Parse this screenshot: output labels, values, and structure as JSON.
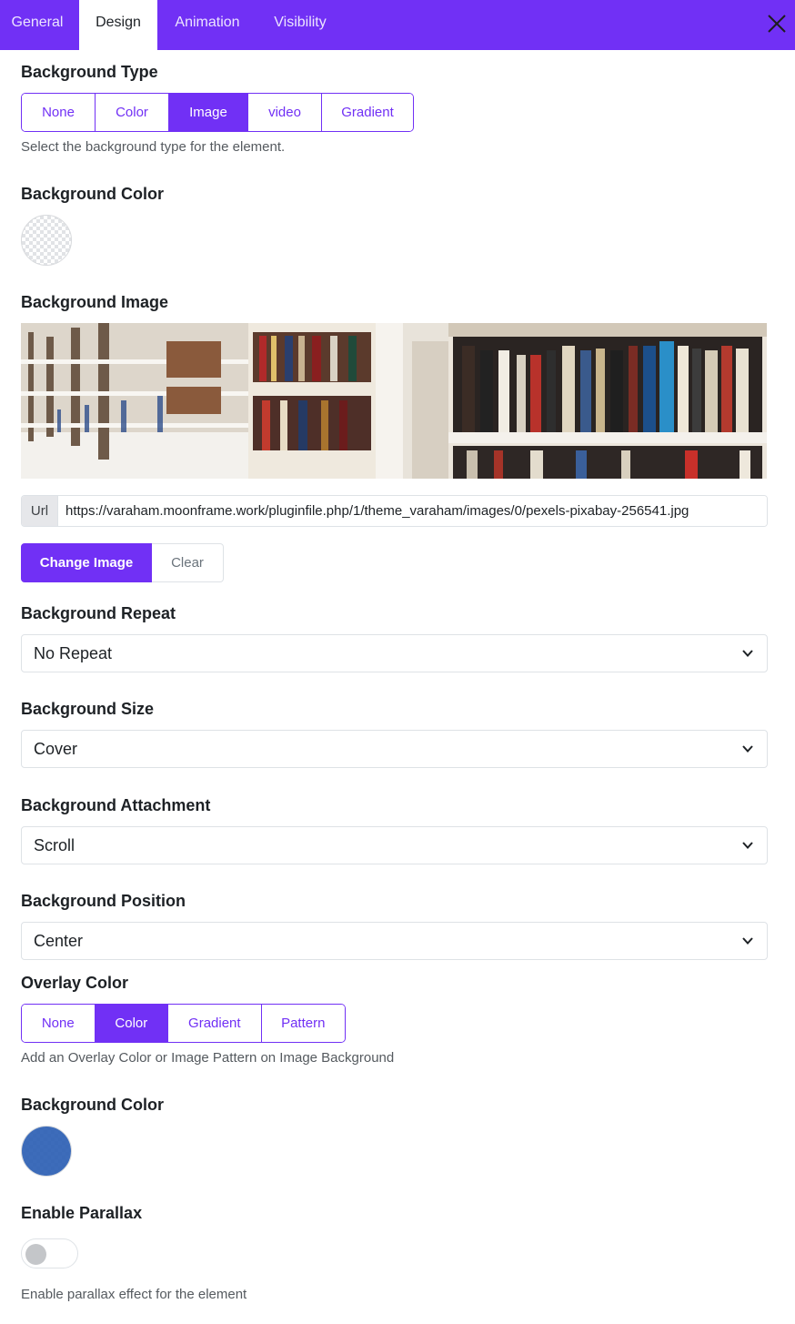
{
  "tabs": [
    {
      "label": "General",
      "active": false
    },
    {
      "label": "Design",
      "active": true
    },
    {
      "label": "Animation",
      "active": false
    },
    {
      "label": "Visibility",
      "active": false
    }
  ],
  "close_icon": "close-icon",
  "background_type": {
    "label": "Background Type",
    "options": [
      "None",
      "Color",
      "Image",
      "video",
      "Gradient"
    ],
    "selected": "Image",
    "help": "Select the background type for the element."
  },
  "background_color": {
    "label": "Background Color",
    "value": "transparent"
  },
  "background_image": {
    "label": "Background Image",
    "url_prefix": "Url",
    "url": "https://varaham.moonframe.work/pluginfile.php/1/theme_varaham/images/0/pexels-pixabay-256541.jpg",
    "change_label": "Change Image",
    "clear_label": "Clear"
  },
  "background_repeat": {
    "label": "Background Repeat",
    "value": "No Repeat"
  },
  "background_size": {
    "label": "Background Size",
    "value": "Cover"
  },
  "background_attachment": {
    "label": "Background Attachment",
    "value": "Scroll"
  },
  "background_position": {
    "label": "Background Position",
    "value": "Center"
  },
  "overlay": {
    "label": "Overlay Color",
    "options": [
      "None",
      "Color",
      "Gradient",
      "Pattern"
    ],
    "selected": "Color",
    "help": "Add an Overlay Color or Image Pattern on Image Background"
  },
  "overlay_color": {
    "label": "Background Color",
    "value": "#2d5fb4"
  },
  "parallax": {
    "label": "Enable Parallax",
    "enabled": false,
    "help": "Enable parallax effect for the element"
  },
  "colors": {
    "accent": "#7130f5",
    "overlay_blue": "#2d5fb4"
  }
}
